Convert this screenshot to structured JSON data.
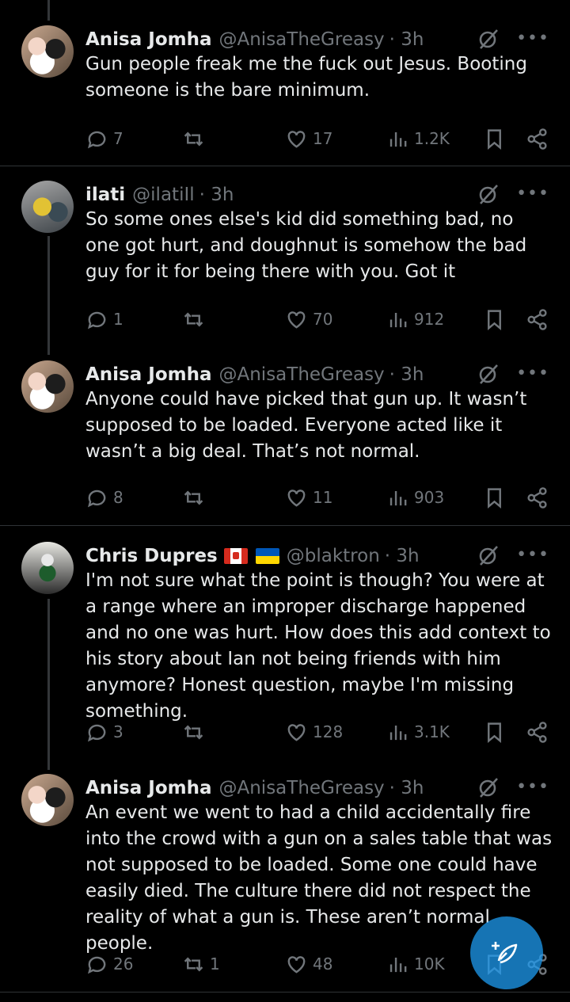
{
  "tweets": [
    {
      "name": "Anisa Jomha",
      "handle": "@AnisaTheGreasy",
      "time": "· 3h",
      "text": "Gun people freak me the fuck out Jesus. Booting someone is the bare minimum.",
      "replies": "7",
      "retweets": "",
      "likes": "17",
      "views": "1.2K"
    },
    {
      "name": "ilati",
      "handle": "@ilatiIl",
      "time": "· 3h",
      "text": "So some ones else's kid did something bad, no one got hurt, and doughnut is somehow the bad guy for it for being there with you. Got it",
      "replies": "1",
      "retweets": "",
      "likes": "70",
      "views": "912"
    },
    {
      "name": "Anisa Jomha",
      "handle": "@AnisaTheGreasy",
      "time": "· 3h",
      "text": "Anyone could have picked that gun up. It wasn’t supposed to be loaded. Everyone acted like it wasn’t a big deal. That’s not normal.",
      "replies": "8",
      "retweets": "",
      "likes": "11",
      "views": "903"
    },
    {
      "name": "Chris Dupres",
      "handle": "@blaktron",
      "time": "· 3h",
      "text": "I'm not sure what the point is though? You were at a range where an improper discharge happened and no one was hurt. How does this add context to his story about Ian not being friends with him anymore? Honest question, maybe I'm missing something.",
      "replies": "3",
      "retweets": "",
      "likes": "128",
      "views": "3.1K"
    },
    {
      "name": "Anisa Jomha",
      "handle": "@AnisaTheGreasy",
      "time": "· 3h",
      "text": "An event we went to had a child accidentally fire into the crowd with a gun on a sales table that was not supposed to be loaded. Some one could have easily died. The culture there did not respect the reality of what a gun is. These aren’t normal people.",
      "replies": "26",
      "retweets": "1",
      "likes": "48",
      "views": "10K"
    }
  ],
  "colors": {
    "accent": "#1d9bf0",
    "muted": "#71767b",
    "background": "#000000",
    "text": "#e7e9ea"
  },
  "icons": [
    "reply-icon",
    "retweet-icon",
    "like-icon",
    "views-icon",
    "bookmark-icon",
    "share-icon",
    "grok-icon",
    "more-icon",
    "compose-icon"
  ]
}
